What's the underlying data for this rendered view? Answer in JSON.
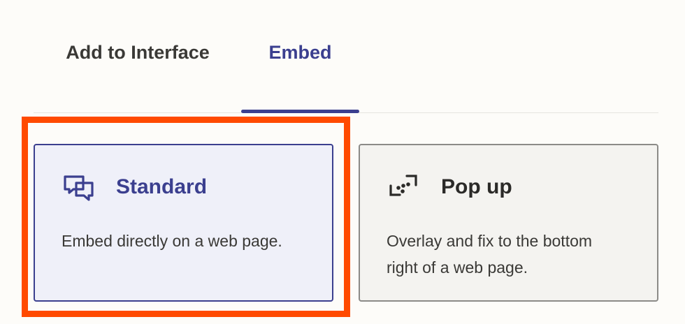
{
  "tabs": [
    {
      "label": "Add to Interface",
      "active": false
    },
    {
      "label": "Embed",
      "active": true
    }
  ],
  "options": [
    {
      "title": "Standard",
      "description": "Embed directly on a web page.",
      "icon": "chat-bubbles-icon",
      "selected": true
    },
    {
      "title": "Pop up",
      "description": "Overlay and fix to the bottom right of a web page.",
      "icon": "popup-dots-icon",
      "selected": false
    }
  ],
  "colors": {
    "accent": "#3b3f8f",
    "highlight": "#ff4a00",
    "background": "#fdfcf9"
  }
}
